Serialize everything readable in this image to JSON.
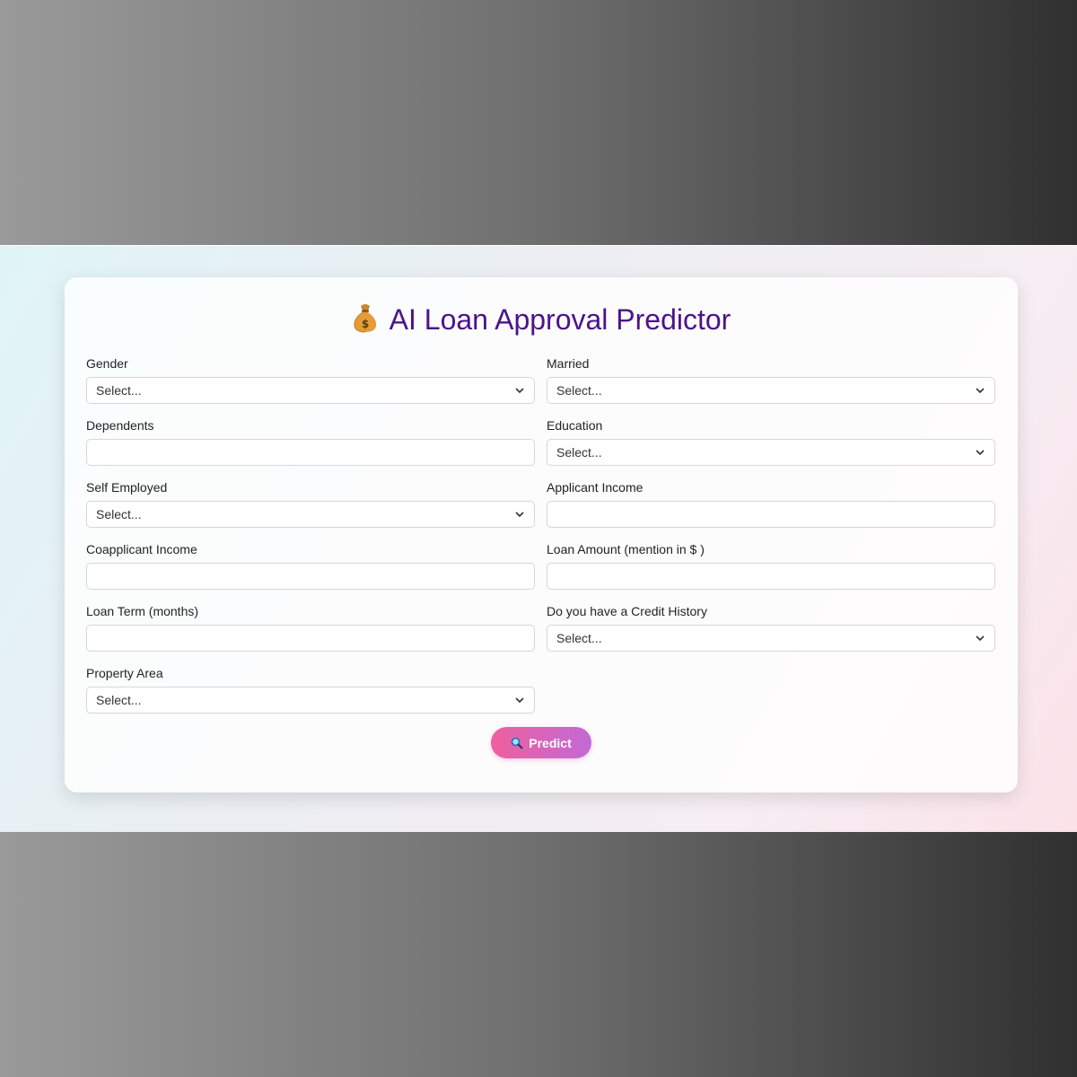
{
  "app": {
    "title": "AI Loan Approval Predictor",
    "title_icon": "money-bag-icon"
  },
  "form": {
    "fields": {
      "gender": {
        "label": "Gender",
        "type": "select",
        "value": "Select..."
      },
      "married": {
        "label": "Married",
        "type": "select",
        "value": "Select..."
      },
      "dependents": {
        "label": "Dependents",
        "type": "text",
        "value": ""
      },
      "education": {
        "label": "Education",
        "type": "select",
        "value": "Select..."
      },
      "self_employed": {
        "label": "Self Employed",
        "type": "select",
        "value": "Select..."
      },
      "applicant_income": {
        "label": "Applicant Income",
        "type": "text",
        "value": ""
      },
      "coapplicant_income": {
        "label": "Coapplicant Income",
        "type": "text",
        "value": ""
      },
      "loan_amount": {
        "label": "Loan Amount (mention in $ )",
        "type": "text",
        "value": ""
      },
      "loan_term": {
        "label": "Loan Term (months)",
        "type": "text",
        "value": ""
      },
      "credit_history": {
        "label": "Do you have a Credit History",
        "type": "select",
        "value": "Select..."
      },
      "property_area": {
        "label": "Property Area",
        "type": "select",
        "value": "Select..."
      }
    },
    "submit": {
      "label": "Predict",
      "icon": "magnifier-icon"
    }
  },
  "colors": {
    "title": "#4a148c",
    "button_start": "#ef5f9c",
    "button_end": "#c16ad6"
  }
}
